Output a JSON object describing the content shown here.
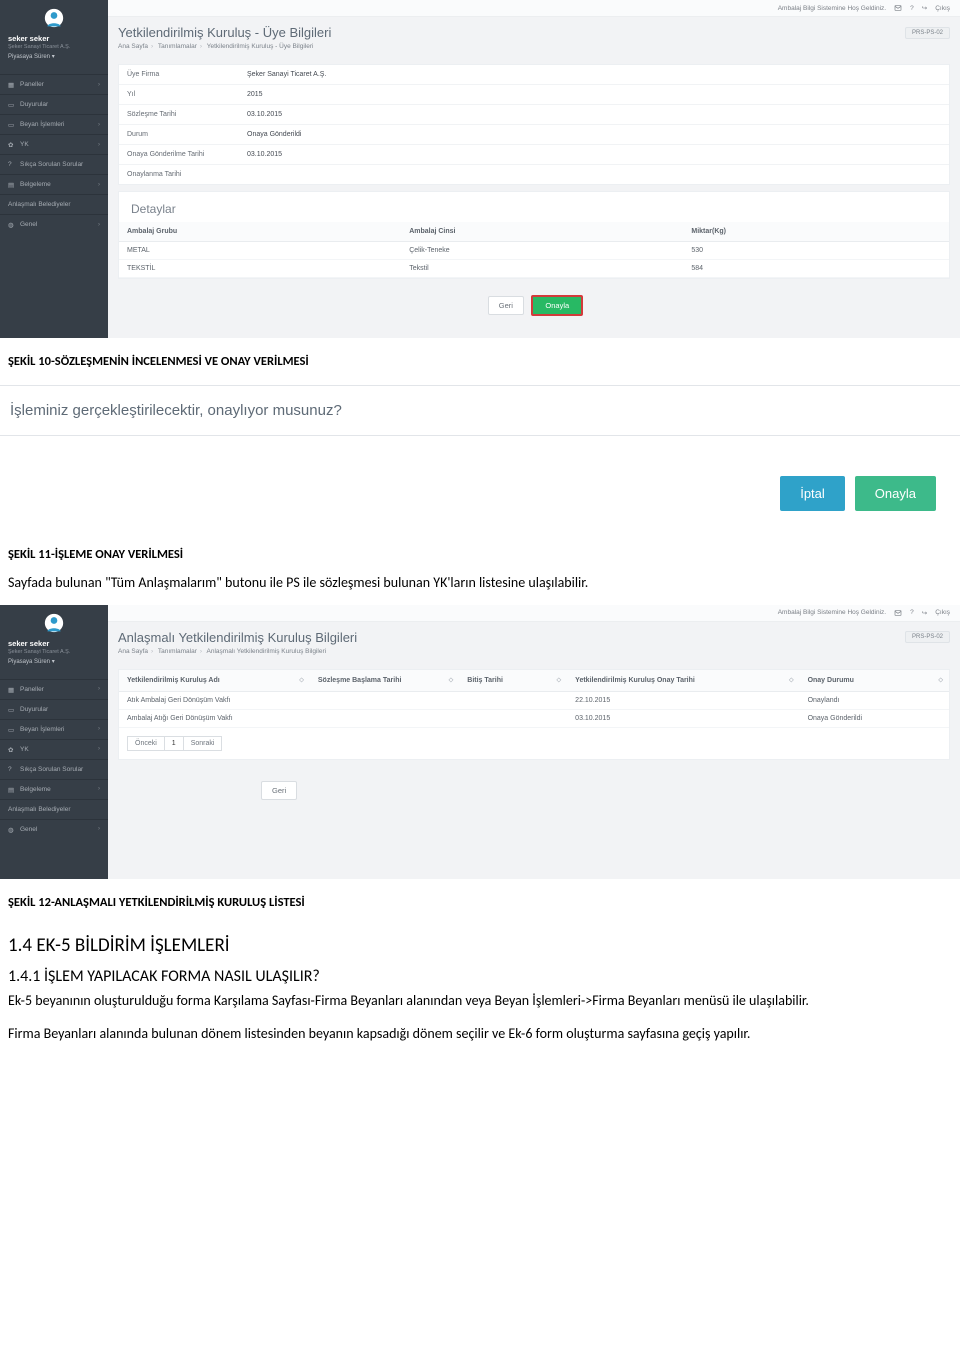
{
  "topbar": {
    "welcome": "Ambalaj Bilgi Sistemine Hoş Geldiniz.",
    "exit": "Çıkış"
  },
  "user": {
    "name": "seker seker",
    "sub": "Şeker Sanayi Ticaret A.Ş.",
    "role": "Piyasaya Süren ▾"
  },
  "nav": {
    "paneller": "Paneller",
    "duyurular": "Duyurular",
    "beyan": "Beyan İşlemleri",
    "yk": "YK",
    "sss": "Sıkça Sorulan Sorular",
    "belgeleme": "Belgeleme",
    "anlasmali": "Anlaşmalı Belediyeler",
    "genel": "Genel"
  },
  "screen1": {
    "title": "Yetkilendirilmiş Kuruluş - Üye Bilgileri",
    "badge": "PRS-PS-02",
    "crumbs": {
      "a": "Ana Sayfa",
      "b": "Tanımlamalar",
      "c": "Yetkilendirilmiş Kuruluş - Üye Bilgileri"
    },
    "rows": {
      "uyeFirmaLbl": "Üye Firma",
      "uyeFirmaVal": "Şeker Sanayi Ticaret A.Ş.",
      "yilLbl": "Yıl",
      "yilVal": "2015",
      "sozTarLbl": "Sözleşme Tarihi",
      "sozTarVal": "03.10.2015",
      "durumLbl": "Durum",
      "durumVal": "Onaya Gönderildi",
      "onayGonLbl": "Onaya Gönderilme Tarihi",
      "onayGonVal": "03.10.2015",
      "onaylanmaLbl": "Onaylanma Tarihi",
      "onaylanmaVal": ""
    },
    "detaylar": "Detaylar",
    "th": {
      "grup": "Ambalaj Grubu",
      "cins": "Ambalaj Cinsi",
      "miktar": "Miktar(Kg)"
    },
    "td": {
      "r1c1": "METAL",
      "r1c2": "Çelik-Teneke",
      "r1c3": "530",
      "r2c1": "TEKSTİL",
      "r2c2": "Tekstil",
      "r2c3": "584"
    },
    "geri": "Geri",
    "onayla": "Onayla"
  },
  "captions": {
    "c10": "ŞEKİL 10-SÖZLEŞMENİN İNCELENMESİ VE ONAY VERİLMESİ",
    "c11": "ŞEKİL 11-İŞLEME ONAY VERİLMESİ",
    "c12": "ŞEKİL 12-ANLAŞMALI YETKİLENDİRİLMİŞ KURULUŞ LİSTESİ"
  },
  "confirm": {
    "msg": "İşleminiz gerçekleştirilecektir, onaylıyor musunuz?",
    "iptal": "İptal",
    "onayla": "Onayla"
  },
  "doc": {
    "p1": "Sayfada bulunan \"Tüm Anlaşmalarım\" butonu ile PS ile sözleşmesi bulunan YK'ların listesine ulaşılabilir.",
    "h14": "1.4   EK-5 BİLDİRİM İŞLEMLERİ",
    "h141": "1.4.1   İŞLEM YAPILACAK FORMA NASIL ULAŞILIR?",
    "p2": "Ek-5 beyanının oluşturulduğu forma Karşılama Sayfası-Firma Beyanları alanından veya Beyan İşlemleri->Firma Beyanları menüsü ile ulaşılabilir.",
    "p3": "Firma Beyanları alanında bulunan dönem listesinden beyanın kapsadığı dönem seçilir ve Ek-6 form oluşturma sayfasına geçiş yapılır."
  },
  "screen2": {
    "title": "Anlaşmalı Yetkilendirilmiş Kuruluş Bilgileri",
    "badge": "PRS-PS-02",
    "crumbs": {
      "a": "Ana Sayfa",
      "b": "Tanımlamalar",
      "c": "Anlaşmalı Yetkilendirilmiş Kuruluş Bilgileri"
    },
    "th": {
      "adi": "Yetkilendirilmiş Kuruluş Adı",
      "bas": "Sözleşme Başlama Tarihi",
      "bit": "Bitiş Tarihi",
      "onay": "Yetkilendirilmiş Kuruluş Onay Tarihi",
      "durum": "Onay Durumu"
    },
    "td": {
      "r1c1": "Atık Ambalaj Geri Dönüşüm Vakfı",
      "r1c4": "22.10.2015",
      "r1c5": "Onaylandı",
      "r2c1": "Ambalaj Atığı Geri Dönüşüm Vakfı",
      "r2c4": "03.10.2015",
      "r2c5": "Onaya Gönderildi"
    },
    "pager": {
      "prev": "Önceki",
      "n1": "1",
      "next": "Sonraki"
    },
    "geri": "Geri"
  }
}
